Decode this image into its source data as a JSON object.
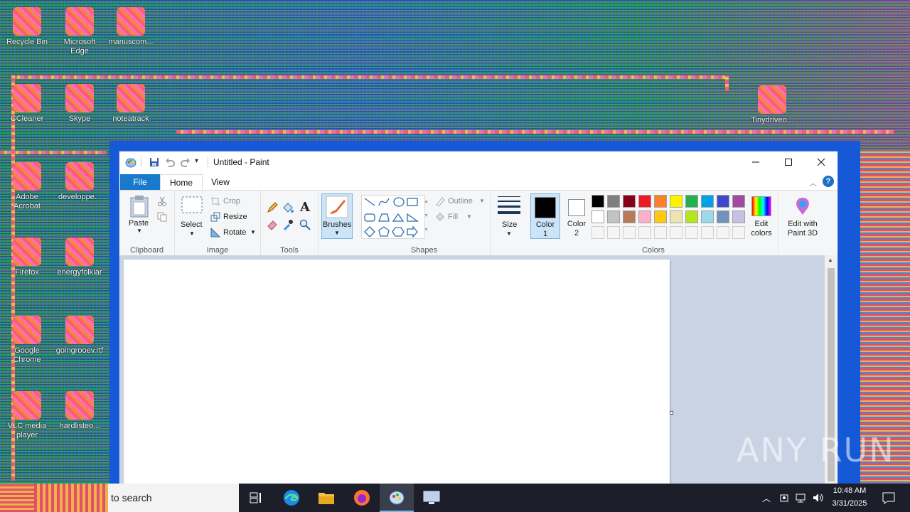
{
  "desktop": {
    "icons": [
      {
        "label": "Recycle Bin"
      },
      {
        "label": "Microsoft Edge"
      },
      {
        "label": "manuscom..."
      },
      {
        "label": "CCleaner"
      },
      {
        "label": "Skype"
      },
      {
        "label": "noteatrack"
      },
      {
        "label": "Adobe Acrobat"
      },
      {
        "label": "developpe..."
      },
      {
        "label": "Firefox"
      },
      {
        "label": "energyfolkiar"
      },
      {
        "label": "Google Chrome"
      },
      {
        "label": "goingrooev.rtf"
      },
      {
        "label": "VLC media player"
      },
      {
        "label": "hardlisteo..."
      },
      {
        "label": "Tinydriveo..."
      }
    ]
  },
  "window": {
    "title": "Untitled - Paint",
    "tabs": [
      "File",
      "Home",
      "View"
    ],
    "ribbon": {
      "clipboard": {
        "paste": "Paste",
        "group": "Clipboard"
      },
      "image": {
        "select": "Select",
        "crop": "Crop",
        "resize": "Resize",
        "rotate": "Rotate",
        "group": "Image"
      },
      "tools": {
        "group": "Tools"
      },
      "brushes": {
        "label": "Brushes"
      },
      "shapes": {
        "outline": "Outline",
        "fill": "Fill",
        "group": "Shapes"
      },
      "size": {
        "label": "Size"
      },
      "colors": {
        "color1": "Color 1",
        "color2": "Color 2",
        "edit_colors": "Edit colors",
        "edit_3d": "Edit with Paint 3D",
        "group": "Colors",
        "color1_value": "#000000",
        "color2_value": "#ffffff",
        "palette_row1": [
          "#000000",
          "#7f7f7f",
          "#880015",
          "#ed1c24",
          "#ff7f27",
          "#fff200",
          "#22b14c",
          "#00a2e8",
          "#3f48cc",
          "#a349a4"
        ],
        "palette_row2": [
          "#ffffff",
          "#c3c3c3",
          "#b97a57",
          "#ffaec9",
          "#ffc90e",
          "#efe4b0",
          "#b5e61d",
          "#99d9ea",
          "#7092be",
          "#c8bfe7"
        ],
        "palette_row3": [
          "#f5f5f5",
          "#f5f5f5",
          "#f5f5f5",
          "#f5f5f5",
          "#f5f5f5",
          "#f5f5f5",
          "#f5f5f5",
          "#f5f5f5",
          "#f5f5f5",
          "#f5f5f5"
        ]
      }
    }
  },
  "taskbar": {
    "search_placeholder": "to search",
    "time": "10:48 AM",
    "date": "3/31/2025"
  },
  "watermark": "ANY RUN"
}
